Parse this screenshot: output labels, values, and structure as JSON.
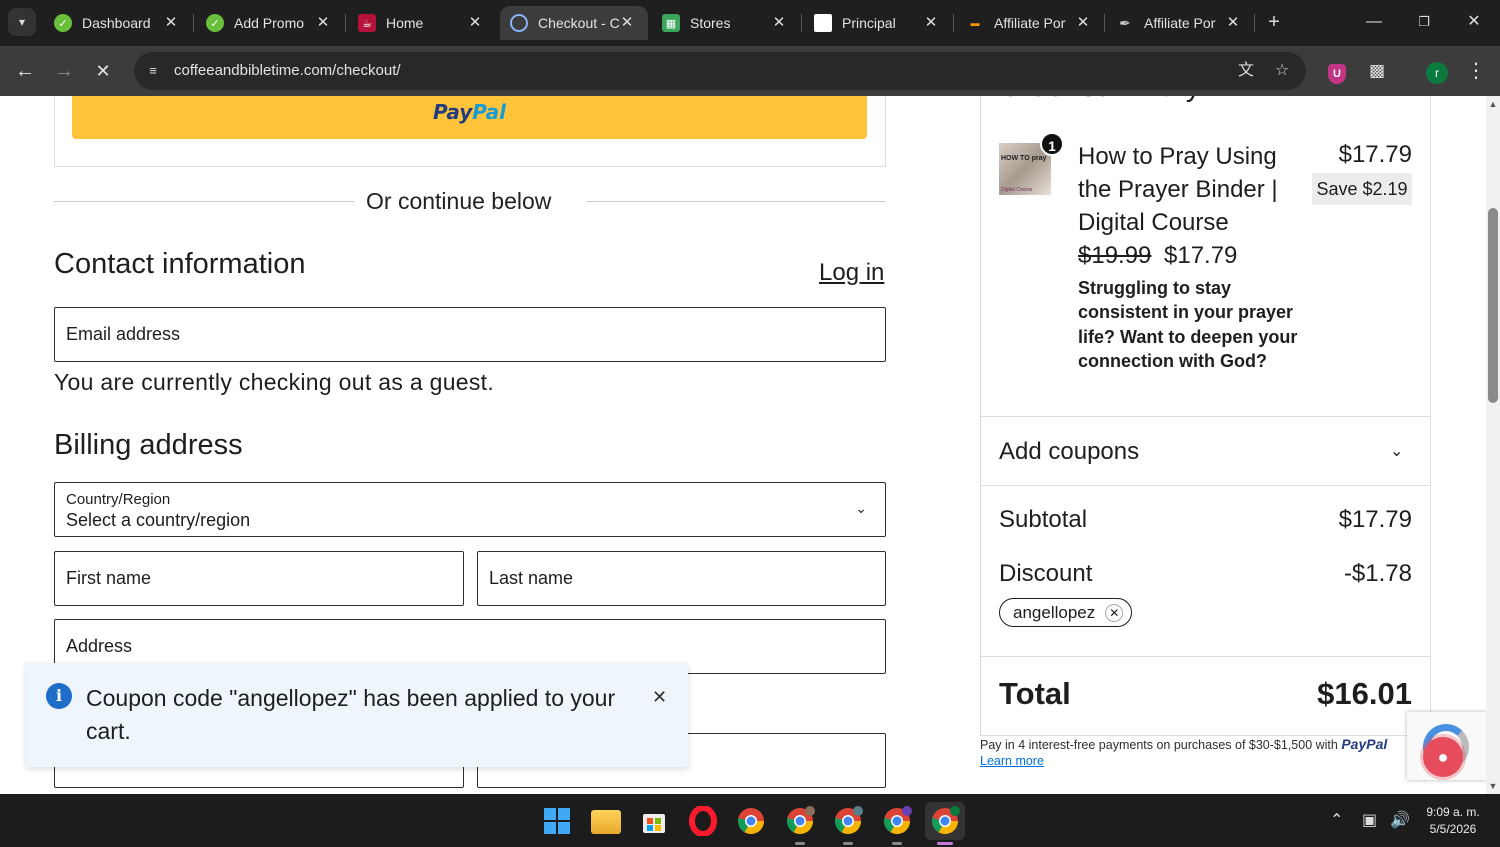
{
  "tabs": [
    {
      "title": "Dashboard",
      "icon": "coupon-check-icon",
      "color": "#6abf3b"
    },
    {
      "title": "Add Promo",
      "icon": "coupon-check-icon",
      "color": "#6abf3b"
    },
    {
      "title": "Home",
      "icon": "coffee-cup-icon",
      "color": "#b3123b"
    },
    {
      "title": "Checkout - C",
      "icon": "loading-icon",
      "color": "#8ab4f8"
    },
    {
      "title": "Stores",
      "icon": "stores-icon",
      "color": "#3ba55c"
    },
    {
      "title": "Principal",
      "icon": "page-icon",
      "color": "#ffffff"
    },
    {
      "title": "Affiliate Port",
      "icon": "brand-icon",
      "color": "#ff9900"
    },
    {
      "title": "Affiliate Port",
      "icon": "feather-icon",
      "color": "#cccccc"
    }
  ],
  "browser": {
    "url": "coffeeandbibletime.com/checkout/",
    "profile_initial": "r"
  },
  "checkout": {
    "paypal_brand_1": "Pay",
    "paypal_brand_2": "Pal",
    "or_continue": "Or continue below",
    "contact_heading": "Contact information",
    "login_label": "Log in",
    "email_placeholder": "Email address",
    "guest_note": "You are currently checking out as a guest.",
    "billing_heading": "Billing address",
    "country_label": "Country/Region",
    "country_value": "Select a country/region",
    "first_name": "First name",
    "last_name": "Last name",
    "address": "Address"
  },
  "notice": {
    "message": "Coupon code \"angellopez\" has been applied to your cart."
  },
  "summary": {
    "title": "Order summary",
    "quantity": "1",
    "thumbnail_text_1": "HOW TO pray",
    "thumbnail_text_2": "Digital Course",
    "product_name": "How to Pray Using the Prayer Binder | Digital Course",
    "product_price": "$17.79",
    "save_badge": "Save $2.19",
    "old_price": "$19.99",
    "new_price": "$17.79",
    "description": "Struggling to stay consistent in your prayer life? Want to deepen your connection with God?",
    "coupons_label": "Add coupons",
    "subtotal_label": "Subtotal",
    "subtotal_value": "$17.79",
    "discount_label": "Discount",
    "discount_value": "-$1.78",
    "coupon_chip": "angellopez",
    "total_label": "Total",
    "total_value": "$16.01",
    "paylater_text": "Pay in 4 interest-free payments on purchases of $30-$1,500 with",
    "paylater_brand": "PayPal",
    "learn_more": "Learn more"
  },
  "taskbar": {
    "time": "9:09 a. m.",
    "date": "5/5/2026"
  }
}
